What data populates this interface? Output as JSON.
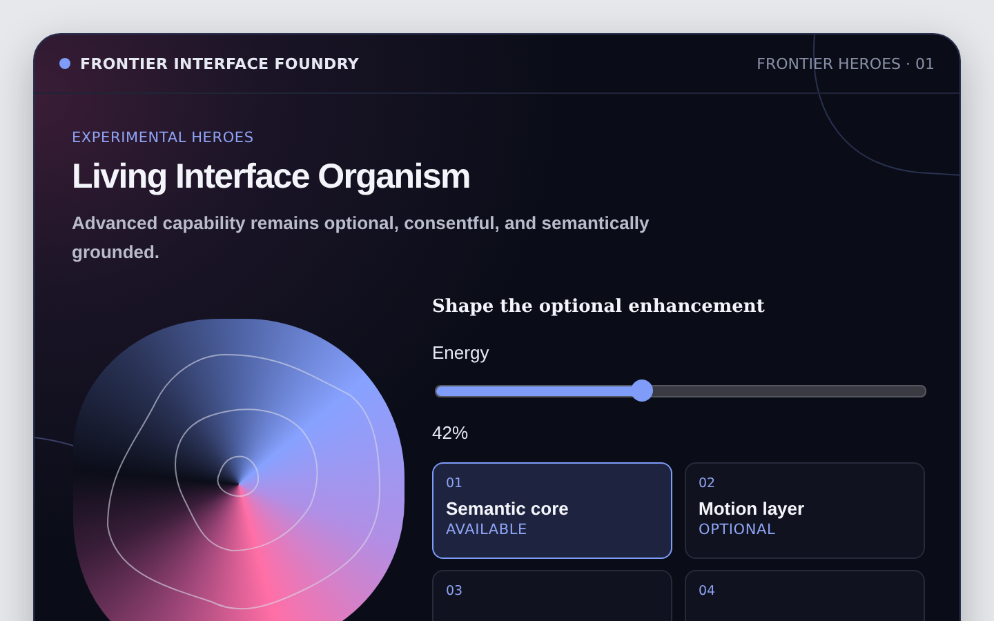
{
  "header": {
    "brand": "FRONTIER INTERFACE FOUNDRY",
    "meta": "FRONTIER HEROES · 01"
  },
  "hero": {
    "eyebrow": "EXPERIMENTAL HEROES",
    "title": "Living Interface Organism",
    "subtitle": "Advanced capability remains optional, consentful, and semantically grounded."
  },
  "panel": {
    "heading": "Shape the optional enhancement",
    "slider": {
      "label": "Energy",
      "level": 0.42,
      "reading": "42%"
    },
    "cards": [
      {
        "number": "01",
        "title": "Semantic core",
        "status": "AVAILABLE",
        "selected": true
      },
      {
        "number": "02",
        "title": "Motion layer",
        "status": "OPTIONAL",
        "selected": false
      },
      {
        "number": "03",
        "selected": false
      },
      {
        "number": "04",
        "selected": false
      }
    ]
  }
}
